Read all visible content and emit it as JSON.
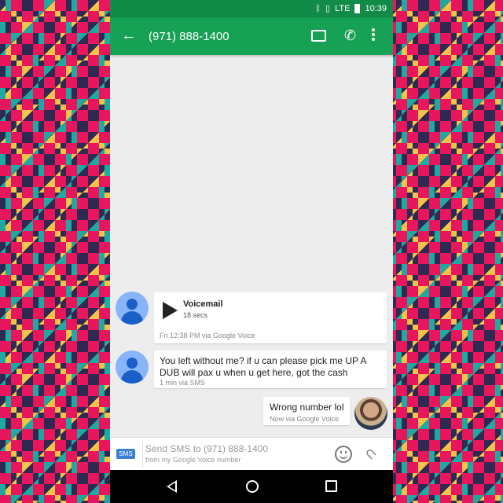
{
  "status_bar": {
    "time": "10:39",
    "network": "LTE"
  },
  "header": {
    "title": "(971) 888-1400"
  },
  "messages": [
    {
      "type": "voicemail",
      "title": "Voicemail",
      "duration": "18 secs",
      "meta": "Fri 12:38 PM via Google Voice"
    },
    {
      "type": "incoming",
      "text": "You left without me? if u can please pick me UP A DUB will pax u when u get here, got the cash",
      "meta": "1 min via SMS"
    },
    {
      "type": "outgoing",
      "text": "Wrong number lol",
      "meta": "Now via Google Voice"
    }
  ],
  "compose": {
    "badge": "SMS",
    "placeholder": "Send SMS to (971) 888-1400",
    "subtext": "from my Google Voice number"
  },
  "colors": {
    "status_bar": "#128a48",
    "app_bar": "#16a154",
    "sms_badge": "#3b7fd6",
    "avatar": "#8ab4f8"
  }
}
